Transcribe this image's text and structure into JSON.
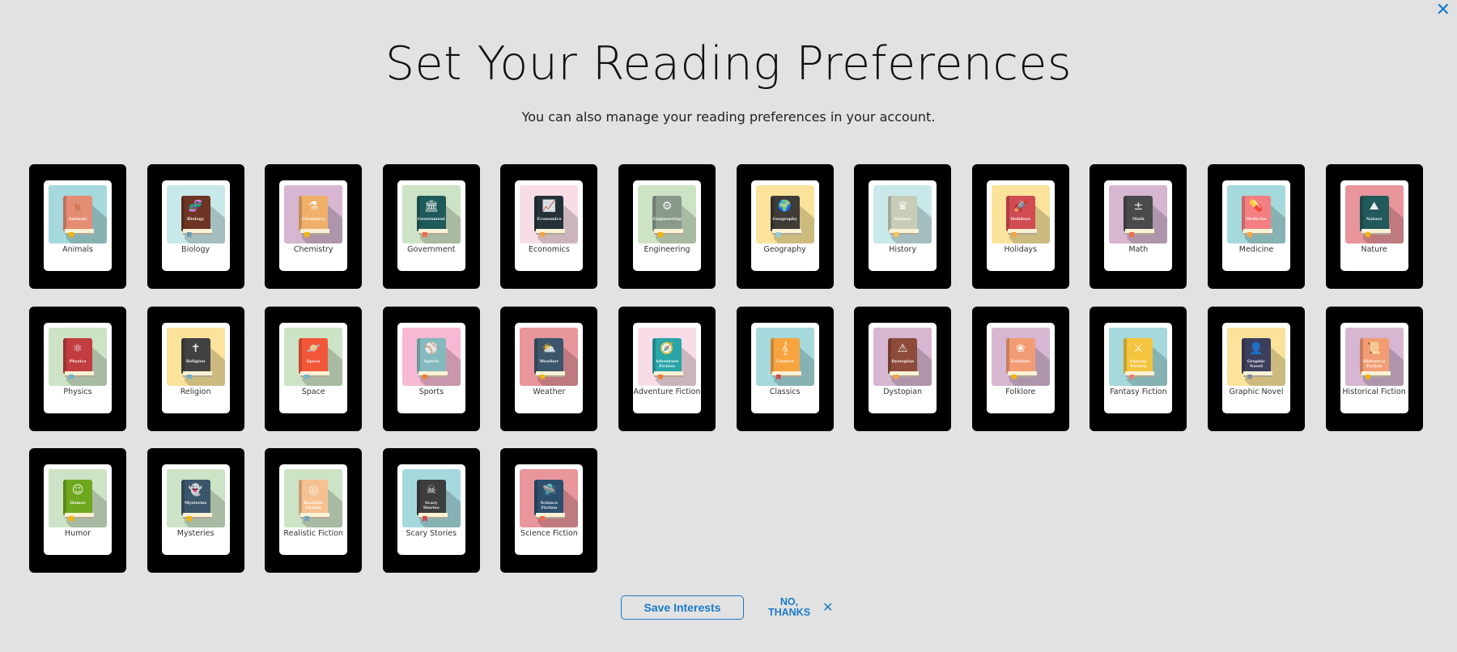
{
  "header": {
    "title": "Set Your Reading Preferences",
    "subtitle": "You can also manage your reading preferences in your account.",
    "close_icon": "✕"
  },
  "colors": {
    "accent": "#1a7bc9",
    "background": "#e2e2e2",
    "tile": "#000000"
  },
  "topics": [
    {
      "label": "Animals",
      "bg": "#a5d9dc",
      "book": "#e58d73",
      "mark": "#f7b500",
      "glyph": "🦌"
    },
    {
      "label": "Biology",
      "bg": "#c9e8ea",
      "book": "#6e3524",
      "mark": "#6a9bb3",
      "glyph": "🧬"
    },
    {
      "label": "Chemistry",
      "bg": "#d6b6d1",
      "book": "#f0b06a",
      "mark": "#f7b500",
      "glyph": "⚗"
    },
    {
      "label": "Government",
      "bg": "#cde3c5",
      "book": "#1f5a5a",
      "mark": "#f26a4b",
      "glyph": "🏛"
    },
    {
      "label": "Economics",
      "bg": "#f8dde7",
      "book": "#243238",
      "mark": "#f7a440",
      "glyph": "📈"
    },
    {
      "label": "Engineering",
      "bg": "#cde3c5",
      "book": "#8a9a8a",
      "mark": "#f7b500",
      "glyph": "⚙"
    },
    {
      "label": "Geography",
      "bg": "#fbe39c",
      "book": "#3f3b35",
      "mark": "#8fd0de",
      "glyph": "🌍"
    },
    {
      "label": "History",
      "bg": "#c9e8ea",
      "book": "#c8cdb7",
      "mark": "#f7c35a",
      "glyph": "♛"
    },
    {
      "label": "Holidays",
      "bg": "#fbe39c",
      "book": "#d04c52",
      "mark": "#f7a440",
      "glyph": "🚀"
    },
    {
      "label": "Math",
      "bg": "#d6b6d1",
      "book": "#4a4a4a",
      "mark": "#f26a4b",
      "glyph": "±"
    },
    {
      "label": "Medicine",
      "bg": "#a5d9dc",
      "book": "#f47f82",
      "mark": "#f7a440",
      "glyph": "💊"
    },
    {
      "label": "Nature",
      "bg": "#e8959c",
      "book": "#22595a",
      "mark": "#f7b500",
      "glyph": "⛰"
    },
    {
      "label": "Physics",
      "bg": "#cde3c5",
      "book": "#c13d40",
      "mark": "#6fb3d0",
      "glyph": "⚛"
    },
    {
      "label": "Religion",
      "bg": "#fbe39c",
      "book": "#424242",
      "mark": "#6fb3d0",
      "glyph": "✝"
    },
    {
      "label": "Space",
      "bg": "#cde3c5",
      "book": "#f3573a",
      "mark": "#6fb3d0",
      "glyph": "🪐"
    },
    {
      "label": "Sports",
      "bg": "#f6b8d2",
      "book": "#84b9be",
      "mark": "#f07d2d",
      "glyph": "⚾"
    },
    {
      "label": "Weather",
      "bg": "#e8959c",
      "book": "#3b566a",
      "mark": "#f7b500",
      "glyph": "⛅"
    },
    {
      "label": "Adventure Fiction",
      "bg": "#f8dde7",
      "book": "#2aa5a8",
      "mark": "#f07d2d",
      "glyph": "🧭"
    },
    {
      "label": "Classics",
      "bg": "#a5d9dc",
      "book": "#f7a440",
      "mark": "#d04c52",
      "glyph": "𝄞"
    },
    {
      "label": "Dystopian",
      "bg": "#d6b6d1",
      "book": "#8d4c3a",
      "mark": "#f7a440",
      "glyph": "⚠"
    },
    {
      "label": "Folklore",
      "bg": "#d6b6d1",
      "book": "#f29c73",
      "mark": "#f7b500",
      "glyph": "❀"
    },
    {
      "label": "Fantasy Fiction",
      "bg": "#a5d9dc",
      "book": "#f3c43d",
      "mark": "#f07d6a",
      "glyph": "⚔"
    },
    {
      "label": "Graphic Novel",
      "bg": "#fbe39c",
      "book": "#3c3f5c",
      "mark": "#8a8a9a",
      "glyph": "👤"
    },
    {
      "label": "Historical Fiction",
      "bg": "#d6b6d1",
      "book": "#f29c73",
      "mark": "#f7b500",
      "glyph": "📜"
    },
    {
      "label": "Humor",
      "bg": "#cde3c5",
      "book": "#6fa81e",
      "mark": "#f7b500",
      "glyph": "☺"
    },
    {
      "label": "Mysteries",
      "bg": "#cde3c5",
      "book": "#3b566a",
      "mark": "#f7b500",
      "glyph": "👻"
    },
    {
      "label": "Realistic Fiction",
      "bg": "#cde3c5",
      "book": "#f6c191",
      "mark": "#6fa3c0",
      "glyph": "◎"
    },
    {
      "label": "Scary Stories",
      "bg": "#a5d9dc",
      "book": "#3d3d3d",
      "mark": "#d04c52",
      "glyph": "☠"
    },
    {
      "label": "Science Fiction",
      "bg": "#e8959c",
      "book": "#2d4f6e",
      "mark": "#f26a4b",
      "glyph": "🛸"
    }
  ],
  "footer": {
    "save_label": "Save Interests",
    "no_thanks_line1": "NO,",
    "no_thanks_line2": "THANKS",
    "dismiss_icon": "✕"
  }
}
